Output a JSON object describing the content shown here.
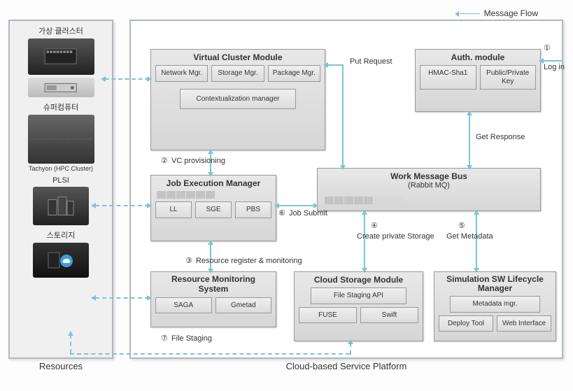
{
  "legend": {
    "label": "Message Flow"
  },
  "captions": {
    "resources": "Resources",
    "platform": "Cloud-based Service Platform"
  },
  "resources": {
    "virtual_cluster": "가상 클러스터",
    "supercomputer": "슈퍼컴퓨터",
    "tachyon": "Tachyon (HPC Cluster)",
    "plsi": "PLSI",
    "storage": "스토리지"
  },
  "modules": {
    "vcm": {
      "title": "Virtual Cluster Module",
      "network": "Network Mgr.",
      "storage": "Storage Mgr.",
      "package": "Package Mgr.",
      "context": "Contextualization manager"
    },
    "auth": {
      "title": "Auth. module",
      "hmac": "HMAC-Sha1",
      "key": "Public/Private Key"
    },
    "jem": {
      "title": "Job Execution Manager",
      "ll": "LL",
      "sge": "SGE",
      "pbs": "PBS"
    },
    "wmb": {
      "title": "Work Message Bus",
      "subtitle": "(Rabbit MQ)"
    },
    "rms": {
      "title": "Resource Monitoring System",
      "saga": "SAGA",
      "gmetad": "Gmetad"
    },
    "csm": {
      "title": "Cloud Storage Module",
      "api": "File Staging API",
      "fuse": "FUSE",
      "swift": "Swift"
    },
    "sslm": {
      "title": "Simulation SW Lifecycle Manager",
      "meta": "Metadata mgr.",
      "deploy": "Deploy Tool",
      "web": "Web Interface"
    }
  },
  "labels": {
    "login": "Log in",
    "put_request": "Put Request",
    "get_response": "Get Response",
    "vc_provisioning": "VC provisioning",
    "job_submit": "Job Submit",
    "create_storage": "Create private Storage",
    "get_metadata": "Get Metadata",
    "resource_register": "Resource register & monitoring",
    "file_staging": "File Staging"
  },
  "steps": {
    "s1": "①",
    "s2": "②",
    "s3": "③",
    "s4": "④",
    "s5": "⑤",
    "s6": "⑥",
    "s7": "⑦"
  }
}
